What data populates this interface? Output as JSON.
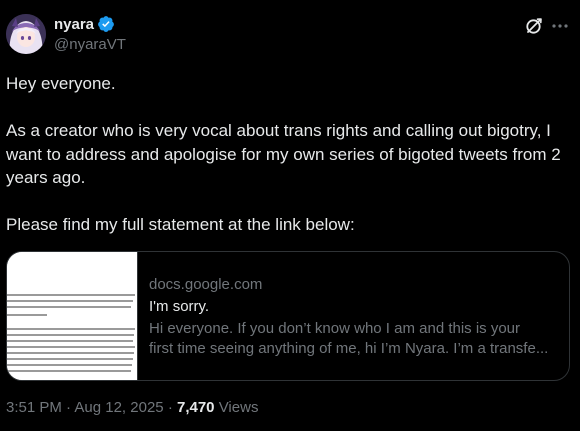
{
  "author": {
    "display_name": "nyara",
    "handle": "@nyaraVT",
    "verified_icon": "verified-badge-icon",
    "avatar_icon": "avatar-image"
  },
  "header_actions": {
    "grok_icon": "grok-icon",
    "more_icon": "more-options-icon"
  },
  "post": {
    "paragraphs": [
      "Hey everyone.",
      "As a creator who is very vocal about trans rights and calling out bigotry, I want to address and apologise for my own series of bigoted tweets from 2 years ago.",
      "Please find my full statement at the link below:"
    ]
  },
  "link_card": {
    "domain": "docs.google.com",
    "title": "I'm sorry.",
    "description_line1": "Hi everyone. If you don’t know who I am and this is your",
    "description_line2": "first time seeing anything of me, hi I’m Nyara. I’m a transfe..."
  },
  "meta": {
    "time": "3:51 PM",
    "separator": "·",
    "date": "Aug 12, 2025",
    "views_count": "7,470",
    "views_label": "Views"
  },
  "colors": {
    "background": "#000000",
    "text_primary": "#e7e9ea",
    "text_secondary": "#71767b",
    "border": "#2f3336",
    "verified_blue": "#1d9bf0"
  }
}
